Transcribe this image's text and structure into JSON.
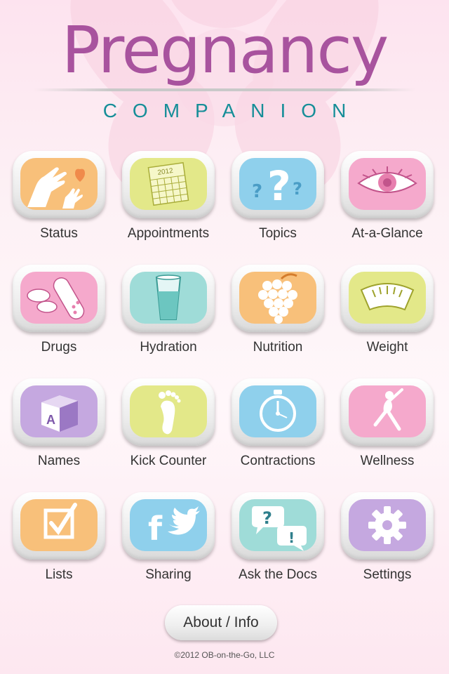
{
  "header": {
    "title": "Pregnancy",
    "subtitle": "COMPANION"
  },
  "tiles": [
    {
      "label": "Status",
      "icon": "hands-heart-icon",
      "color": "#f8c07a"
    },
    {
      "label": "Appointments",
      "icon": "calendar-icon",
      "color": "#e3e889",
      "year": "2012"
    },
    {
      "label": "Topics",
      "icon": "question-marks-icon",
      "color": "#8fd0ec"
    },
    {
      "label": "At-a-Glance",
      "icon": "eye-icon",
      "color": "#f5a9cc"
    },
    {
      "label": "Drugs",
      "icon": "pills-icon",
      "color": "#f5a9cc"
    },
    {
      "label": "Hydration",
      "icon": "water-glass-icon",
      "color": "#9fdcd8"
    },
    {
      "label": "Nutrition",
      "icon": "grapes-icon",
      "color": "#f8c07a"
    },
    {
      "label": "Weight",
      "icon": "scale-icon",
      "color": "#e3e889"
    },
    {
      "label": "Names",
      "icon": "alphabet-block-icon",
      "color": "#c5a8e0",
      "block_letter": "A"
    },
    {
      "label": "Kick Counter",
      "icon": "footprint-icon",
      "color": "#e3e889"
    },
    {
      "label": "Contractions",
      "icon": "stopwatch-icon",
      "color": "#8fd0ec"
    },
    {
      "label": "Wellness",
      "icon": "pregnant-woman-icon",
      "color": "#f5a9cc"
    },
    {
      "label": "Lists",
      "icon": "checkbox-icon",
      "color": "#f8c07a"
    },
    {
      "label": "Sharing",
      "icon": "facebook-twitter-icon",
      "color": "#8fd0ec"
    },
    {
      "label": "Ask the Docs",
      "icon": "speech-bubbles-icon",
      "color": "#9fdcd8"
    },
    {
      "label": "Settings",
      "icon": "gear-icon",
      "color": "#c5a8e0"
    }
  ],
  "about_button": "About / Info",
  "copyright": "©2012 OB-on-the-Go, LLC"
}
